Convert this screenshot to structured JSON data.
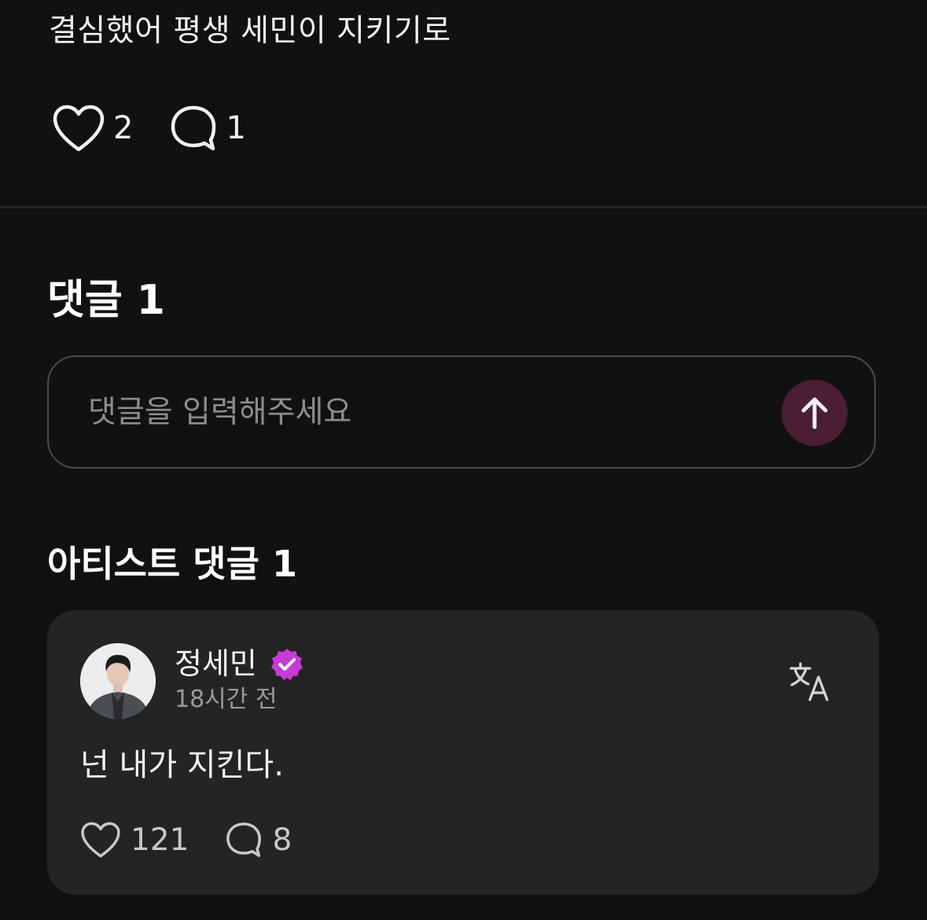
{
  "post": {
    "text": "결심했어 평생 세민이 지키기로",
    "like_count": "2",
    "comment_count": "1"
  },
  "comments_section": {
    "title": "댓글 1",
    "input_placeholder": "댓글을 입력해주세요"
  },
  "artist_section": {
    "title": "아티스트 댓글 1",
    "comment": {
      "author": "정세민",
      "timestamp": "18시간 전",
      "text": "넌 내가 지킨다.",
      "like_count": "121",
      "reply_count": "8"
    }
  },
  "icons": {
    "like": "heart-icon",
    "comment": "comment-bubble-icon",
    "send": "arrow-up-icon",
    "verified": "verified-badge-icon",
    "translate": "translate-icon"
  },
  "colors": {
    "background": "#121112",
    "card": "#242424",
    "send_button": "#4b1e33",
    "verified_badge": "#c53bd6"
  }
}
